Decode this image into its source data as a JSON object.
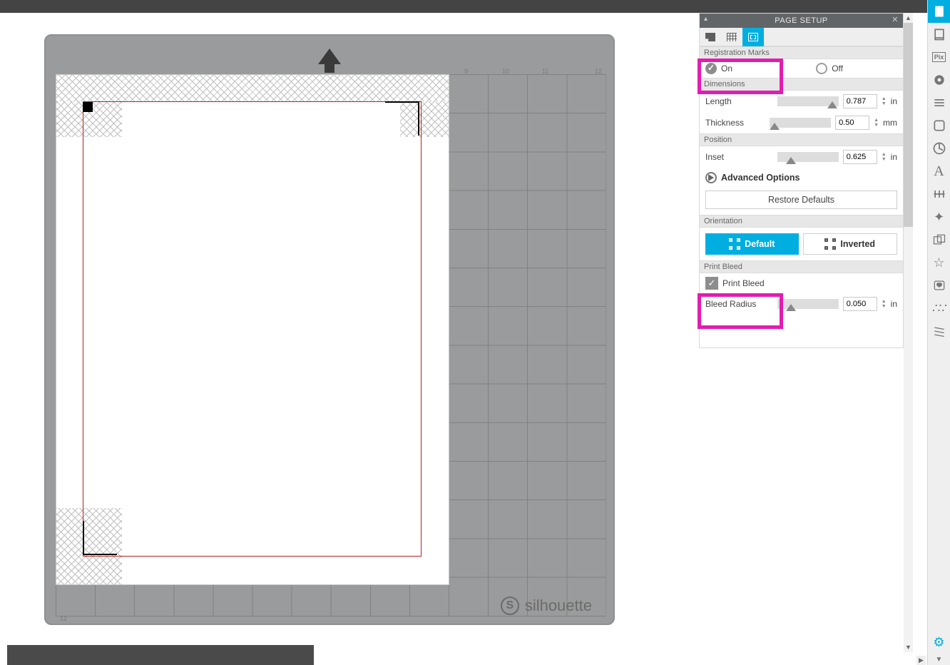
{
  "panel": {
    "title": "PAGE SETUP",
    "sections": {
      "registration_marks": {
        "header": "Registration Marks",
        "on_label": "On",
        "off_label": "Off",
        "value": "on"
      },
      "dimensions": {
        "header": "Dimensions",
        "length_label": "Length",
        "length_value": "0.787",
        "length_unit": "in",
        "thickness_label": "Thickness",
        "thickness_value": "0.50",
        "thickness_unit": "mm"
      },
      "position": {
        "header": "Position",
        "inset_label": "Inset",
        "inset_value": "0.625",
        "inset_unit": "in"
      },
      "advanced_label": "Advanced Options",
      "restore_label": "Restore Defaults",
      "orientation": {
        "header": "Orientation",
        "default_label": "Default",
        "inverted_label": "Inverted"
      },
      "print_bleed": {
        "header": "Print Bleed",
        "checkbox_label": "Print Bleed",
        "checked": true,
        "radius_label": "Bleed Radius",
        "radius_value": "0.050",
        "radius_unit": "in"
      }
    }
  },
  "canvas": {
    "brand": "silhouette",
    "ruler_top": [
      "9",
      "10",
      "11",
      "12"
    ],
    "ruler_side_bottom": "12"
  },
  "right_toolbar_icons": [
    "page-setup-icon",
    "send-icon",
    "pixscan-icon",
    "fill-icon",
    "line-style-icon",
    "trace-icon",
    "transform-icon",
    "text-icon",
    "align-icon",
    "effects-icon",
    "offset-icon",
    "sticker-icon",
    "heart-icon",
    "rhinestone-icon",
    "sketch-icon"
  ]
}
